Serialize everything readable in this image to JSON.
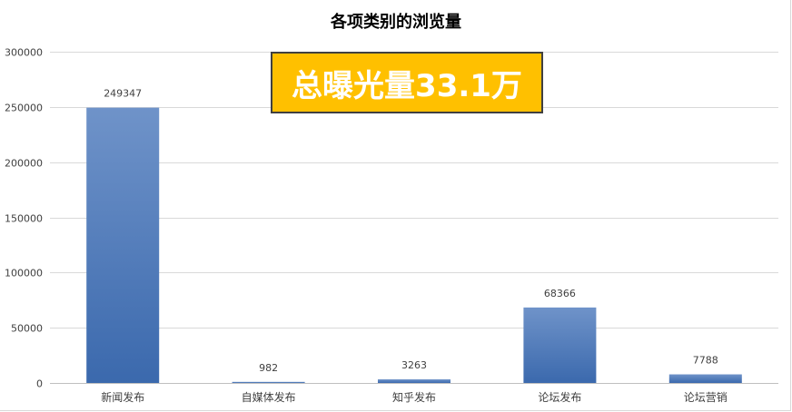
{
  "chart_data": {
    "type": "bar",
    "title": "各项类别的浏览量",
    "categories": [
      "新闻发布",
      "自媒体发布",
      "知乎发布",
      "论坛发布",
      "论坛营销"
    ],
    "values": [
      249347,
      982,
      3263,
      68366,
      7788
    ],
    "data_labels": [
      "249347",
      "982",
      "3263",
      "68366",
      "7788"
    ],
    "yticks": [
      "0",
      "50000",
      "100000",
      "150000",
      "200000",
      "250000",
      "300000"
    ],
    "ylim": [
      0,
      300000
    ],
    "grid": true,
    "legend": "none",
    "bar_color_top": "#6f93c9",
    "bar_color_bottom": "#3b69ad"
  },
  "annotation": {
    "text": "总曝光量33.1万",
    "background": "#ffc000",
    "text_color": "#ffffff"
  }
}
